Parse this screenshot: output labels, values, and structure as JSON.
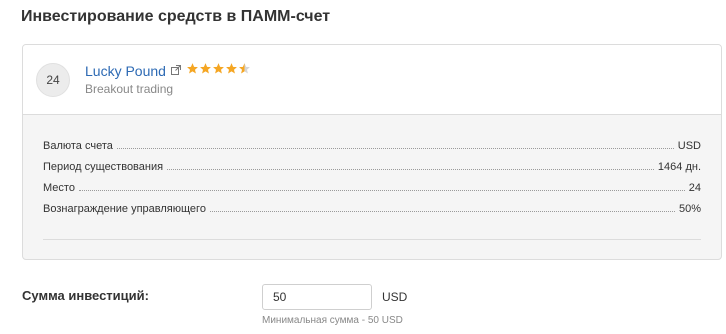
{
  "page": {
    "title": "Инвестирование средств в ПАММ-счет"
  },
  "account": {
    "rank": "24",
    "name": "Lucky Pound",
    "strategy": "Breakout trading",
    "rating": 4.5,
    "rating_max": 5,
    "link_icon": "external-link-icon",
    "accent_color": "#2d6ab4",
    "star_color": "#f5a623"
  },
  "details": [
    {
      "label": "Валюта счета",
      "value": "USD"
    },
    {
      "label": "Период существования",
      "value": "1464 дн."
    },
    {
      "label": "Место",
      "value": "24"
    },
    {
      "label": "Вознаграждение управляющего",
      "value": "50%"
    }
  ],
  "investment": {
    "label": "Сумма инвестиций:",
    "amount": "50",
    "currency": "USD",
    "min_note": "Минимальная сумма - 50 USD"
  }
}
